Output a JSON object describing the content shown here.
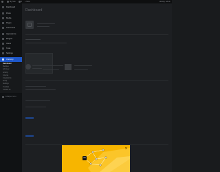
{
  "admin_bar": {
    "site_name": "My Site",
    "comments": "0",
    "new": "+ New",
    "greeting": "Howdy, admin"
  },
  "sidebar": {
    "top_items": [
      {
        "label": "Dashboard",
        "icon": "dashboard-icon"
      }
    ],
    "content_items": [
      {
        "label": "Posts",
        "icon": "pin-icon"
      },
      {
        "label": "Media",
        "icon": "media-icon"
      },
      {
        "label": "Pages",
        "icon": "page-icon"
      },
      {
        "label": "Comments",
        "icon": "comment-icon"
      }
    ],
    "system_items": [
      {
        "label": "Appearance",
        "icon": "brush-icon"
      },
      {
        "label": "Plugins",
        "icon": "plug-icon"
      },
      {
        "label": "Users",
        "icon": "user-icon"
      },
      {
        "label": "Tools",
        "icon": "wrench-icon"
      },
      {
        "label": "Settings",
        "icon": "settings-icon"
      }
    ],
    "current_item": {
      "label": "Uncanny",
      "icon": "plugin-logo-icon"
    },
    "submenu": [
      "Dashboard",
      "Recipes",
      "Add new",
      "Activity",
      "License",
      "Integrations",
      "Setup",
      "Settings",
      "Tutorials",
      "Contact us"
    ],
    "collapse_label": "Collapse menu"
  },
  "main": {
    "page_title": "Dashboard"
  },
  "popup": {
    "close": "×",
    "logo_text": "ua"
  }
}
